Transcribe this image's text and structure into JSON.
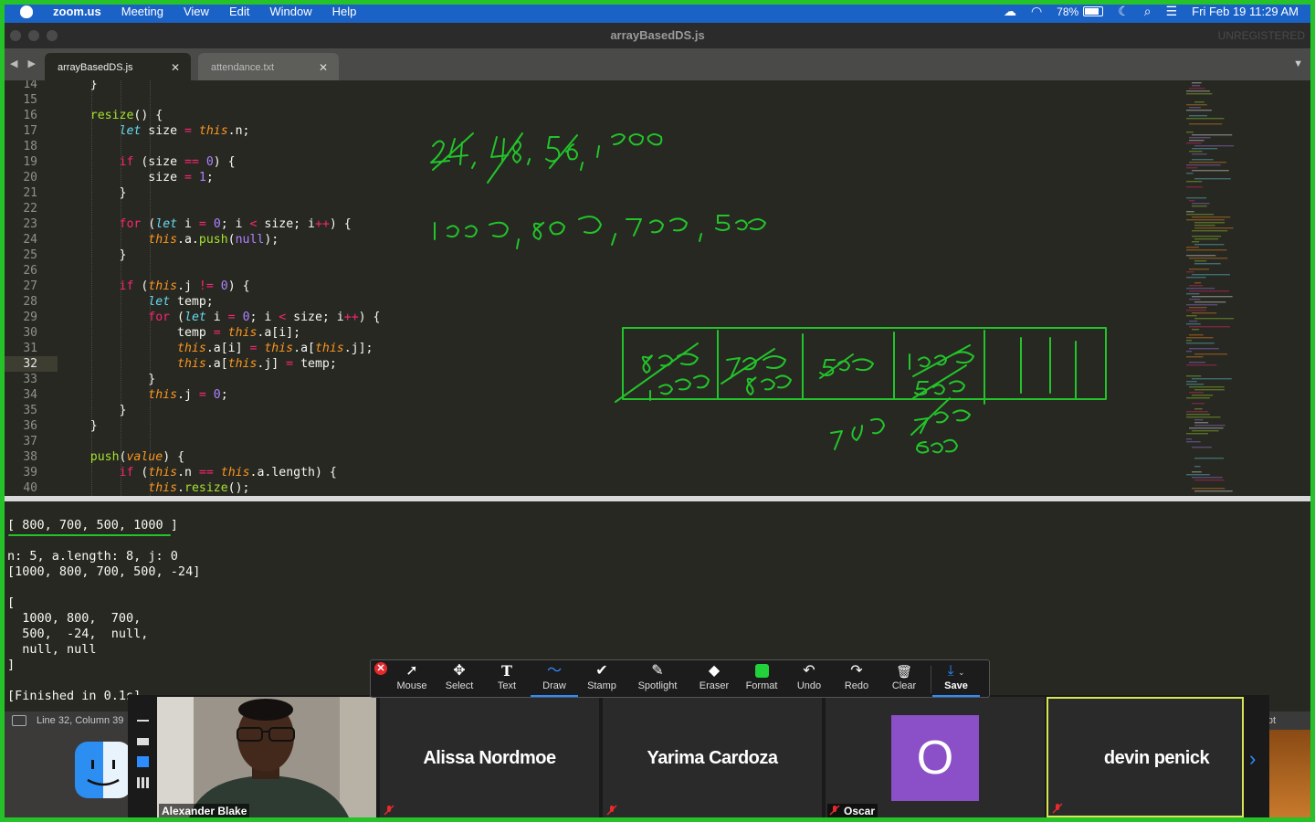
{
  "menubar": {
    "app_name": "zoom.us",
    "items": [
      "Meeting",
      "View",
      "Edit",
      "Window",
      "Help"
    ],
    "battery": "78%",
    "datetime": "Fri Feb 19  11:29 AM"
  },
  "window": {
    "title": "arrayBasedDS.js",
    "unregistered": "UNREGISTERED"
  },
  "tabs": [
    {
      "label": "arrayBasedDS.js",
      "active": true
    },
    {
      "label": "attendance.txt",
      "active": false
    }
  ],
  "editor": {
    "line_numbers": [
      "14",
      "15",
      "16",
      "17",
      "18",
      "19",
      "20",
      "21",
      "22",
      "23",
      "24",
      "25",
      "26",
      "27",
      "28",
      "29",
      "30",
      "31",
      "32",
      "33",
      "34",
      "35",
      "36",
      "37",
      "38",
      "39",
      "40"
    ],
    "current_line": "32"
  },
  "output": {
    "lines": [
      "[ 800, 700, 500, 1000 ]",
      "",
      "n: 5, a.length: 8, j: 0",
      "[1000, 800, 700, 500, -24]",
      "",
      "[",
      "  1000, 800,  700,",
      "  500,  -24,  null,",
      "  null, null",
      "]",
      "",
      "[Finished in 0.1s]"
    ]
  },
  "statusbar": {
    "position": "Line 32, Column 39",
    "syntax": "ript"
  },
  "annotation_toolbar": {
    "tools": [
      {
        "label": "Mouse",
        "icon": "mouse-pointer-icon",
        "glyph": "➚"
      },
      {
        "label": "Select",
        "icon": "move-icon",
        "glyph": "✥"
      },
      {
        "label": "Text",
        "icon": "text-icon",
        "glyph": "T"
      },
      {
        "label": "Draw",
        "icon": "draw-squiggle-icon",
        "glyph": "〜"
      },
      {
        "label": "Stamp",
        "icon": "checkmark-icon",
        "glyph": "✔"
      },
      {
        "label": "Spotlight",
        "icon": "magic-wand-icon",
        "glyph": "✎"
      },
      {
        "label": "Eraser",
        "icon": "eraser-icon",
        "glyph": "◆"
      },
      {
        "label": "Format",
        "icon": "color-swatch-icon",
        "glyph": ""
      },
      {
        "label": "Undo",
        "icon": "undo-icon",
        "glyph": "↶"
      },
      {
        "label": "Redo",
        "icon": "redo-icon",
        "glyph": "↷"
      },
      {
        "label": "Clear",
        "icon": "trash-icon",
        "glyph": "🗑"
      },
      {
        "label": "Save",
        "icon": "save-icon",
        "glyph": "⤓"
      }
    ],
    "selected": "Draw",
    "format_color": "#22d23a"
  },
  "participants": [
    {
      "name": "Alexander Blake",
      "video": true
    },
    {
      "name": "Alissa Nordmoe",
      "video": false
    },
    {
      "name": "Yarima Cardoza",
      "video": false
    },
    {
      "name": "Oscar",
      "video": false,
      "avatar_letter": "O",
      "avatar_color": "#8b4fc8"
    },
    {
      "name": "devin penick",
      "video": false,
      "active_speaker": true
    }
  ],
  "ink_color": "#22c42a"
}
